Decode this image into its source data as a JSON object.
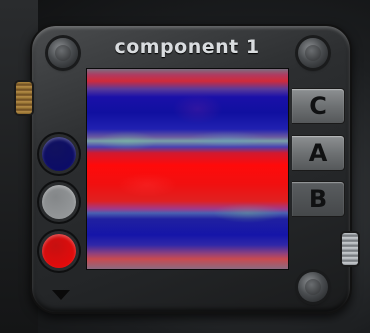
{
  "panel": {
    "title": "component 1"
  },
  "swatches": [
    {
      "name": "blue",
      "color": "#0a0a6a"
    },
    {
      "name": "gray",
      "color": "#9a9d9f"
    },
    {
      "name": "red",
      "color": "#ee0a0a"
    }
  ],
  "tabs": [
    {
      "label": "C"
    },
    {
      "label": "A"
    },
    {
      "label": "B"
    }
  ],
  "icons": {
    "expand": "triangle-down-icon"
  }
}
